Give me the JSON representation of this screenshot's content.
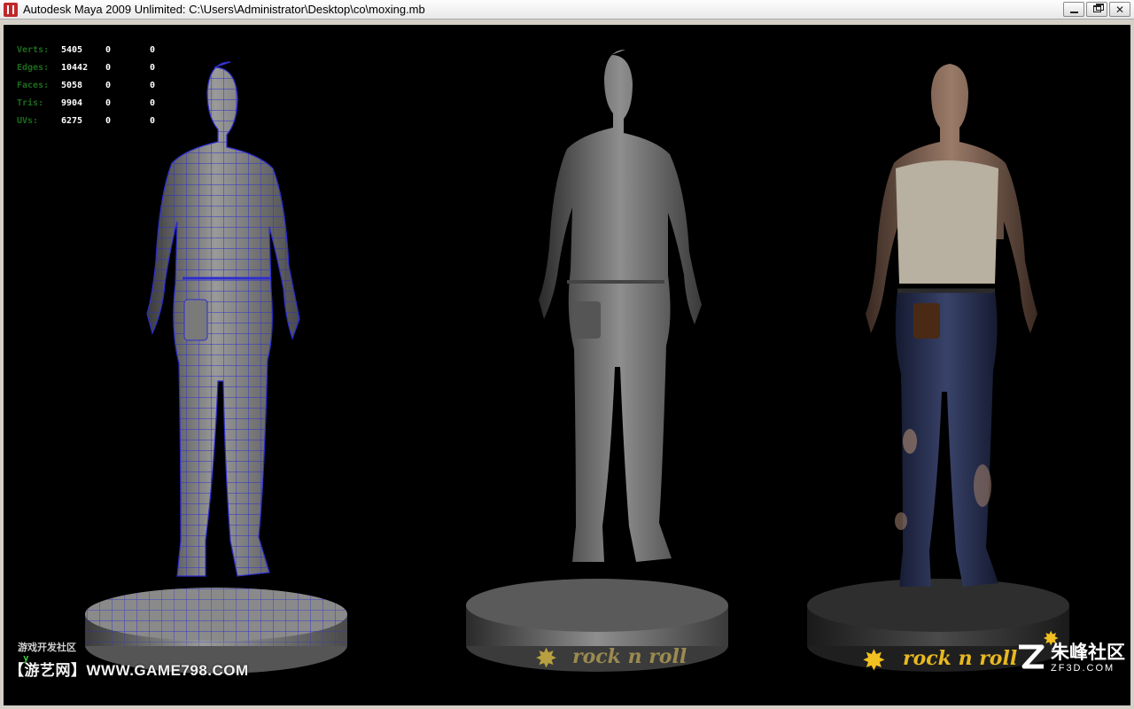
{
  "window": {
    "title": "Autodesk Maya 2009 Unlimited: C:\\Users\\Administrator\\Desktop\\co\\moxing.mb",
    "buttons": {
      "minimize": "minimize",
      "maximize": "restore",
      "close": "✕"
    }
  },
  "hud": {
    "rows": [
      {
        "label": "Verts:",
        "value": "5405",
        "sel": "0",
        "extra": "0"
      },
      {
        "label": "Edges:",
        "value": "10442",
        "sel": "0",
        "extra": "0"
      },
      {
        "label": "Faces:",
        "value": "5058",
        "sel": "0",
        "extra": "0"
      },
      {
        "label": "Tris:",
        "value": "9904",
        "sel": "0",
        "extra": "0"
      },
      {
        "label": "UVs:",
        "value": "6275",
        "sel": "0",
        "extra": "0"
      }
    ]
  },
  "viewport": {
    "models": [
      {
        "name": "wireframe-model",
        "shading": "wireframe-on-shaded"
      },
      {
        "name": "gray-sculpt-model",
        "shading": "smooth-shaded"
      },
      {
        "name": "textured-model",
        "shading": "textured"
      }
    ],
    "pedestal_text": "rock n roll",
    "axis_label": "y"
  },
  "watermarks": {
    "small": "游戏开发社区",
    "site": "【游艺网】WWW.GAME798.COM",
    "logo_cn": "朱峰社区",
    "logo_en": "ZF3D.COM"
  },
  "colors": {
    "wire": "#2d2dcf",
    "hud_label": "#1c6b1c",
    "pedestal_text": "#e8b820"
  }
}
